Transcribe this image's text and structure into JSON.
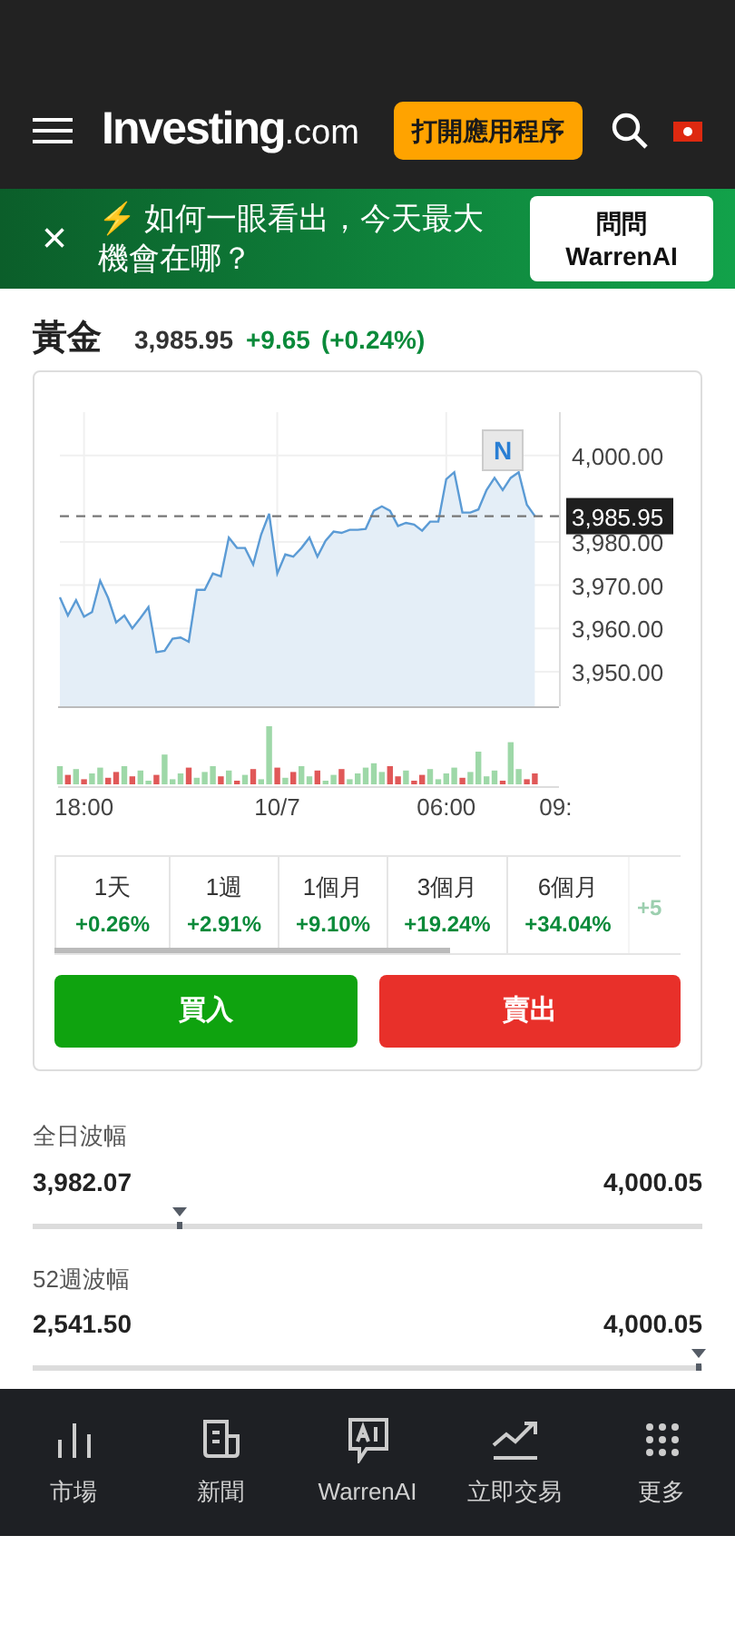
{
  "header": {
    "logo_main": "Investing",
    "logo_suffix": ".com",
    "open_app_button": "打開應用程序"
  },
  "banner": {
    "close": "×",
    "icon": "⚡",
    "text": "如何一眼看出，今天最大機會在哪？",
    "button_line_1": "問問",
    "button_line_2": "WarrenAI"
  },
  "instrument": {
    "name": "黃金",
    "price": "3,985.95",
    "change": "+9.65",
    "change_percent": "(+0.24%)"
  },
  "chart": {
    "news_marker": "N",
    "x_edge_label": "09:",
    "chart_data": {
      "type": "area",
      "grid": true,
      "ref_lines": [
        {
          "axis": "y",
          "value": 3985.95,
          "label": "3,985.95"
        }
      ],
      "categories": [
        null,
        null,
        null,
        "18:00",
        null,
        null,
        null,
        null,
        null,
        null,
        null,
        null,
        null,
        null,
        null,
        null,
        null,
        null,
        null,
        null,
        null,
        null,
        null,
        null,
        null,
        null,
        null,
        "10/7",
        null,
        null,
        null,
        null,
        null,
        null,
        null,
        null,
        null,
        null,
        null,
        null,
        null,
        null,
        null,
        null,
        null,
        null,
        null,
        null,
        "06:00",
        null,
        null,
        null,
        null,
        null,
        null,
        null,
        null,
        null,
        null,
        null,
        null,
        null
      ],
      "series": [
        {
          "color": "#5b9bd5",
          "values": [
            3967.2,
            3963,
            3966.5,
            3962.7,
            3963.8,
            3971,
            3967,
            3961.4,
            3963,
            3960,
            3962.4,
            3964.9,
            3954.5,
            3954.8,
            3957.6,
            3957.9,
            3956.9,
            3968.9,
            3968.9,
            3972.7,
            3972,
            3981,
            3978.6,
            3978.6,
            3974.8,
            3981.7,
            3986.5,
            3972.7,
            3977.1,
            3976.6,
            3978.6,
            3981,
            3976.6,
            3980.3,
            3982.4,
            3982.1,
            3982.8,
            3982.8,
            3983,
            3987.2,
            3988.2,
            3987.2,
            3983.7,
            3984.4,
            3984,
            3982.6,
            3984.7,
            3984.7,
            3994.5,
            3996.1,
            3986.8,
            3986.8,
            3987.5,
            3992,
            3994.8,
            3992,
            3994.8,
            3996.1,
            3988.6,
            3986,
            null,
            null
          ]
        }
      ],
      "ylim": [
        3942,
        4010
      ],
      "yticks": [
        {
          "value": 4000,
          "label": "4,000.00"
        },
        {
          "value": 3980,
          "label": "3,980.00"
        },
        {
          "value": 3970,
          "label": "3,970.00"
        },
        {
          "value": 3960,
          "label": "3,960.00"
        },
        {
          "value": 3950,
          "label": "3,950.00"
        }
      ]
    }
  },
  "periods": [
    {
      "label": "1天",
      "change": "+0.26%"
    },
    {
      "label": "1週",
      "change": "+2.91%"
    },
    {
      "label": "1個月",
      "change": "+9.10%"
    },
    {
      "label": "3個月",
      "change": "+19.24%"
    },
    {
      "label": "6個月",
      "change": "+34.04%"
    },
    {
      "change": "+5"
    }
  ],
  "actions": {
    "buy": "買入",
    "sell": "賣出"
  },
  "ranges": [
    {
      "title": "全日波幅",
      "low": "3,982.07",
      "high": "4,000.05",
      "level": 0.22
    },
    {
      "title": "52週波幅",
      "low": "2,541.50",
      "high": "4,000.05",
      "level": 0.995
    }
  ],
  "bottom_nav": [
    {
      "kind": "markets",
      "label": "市場"
    },
    {
      "kind": "news",
      "label": "新聞"
    },
    {
      "kind": "ai",
      "label": "WarrenAI"
    },
    {
      "kind": "trade",
      "label": "立即交易"
    },
    {
      "kind": "more",
      "label": "更多"
    }
  ]
}
